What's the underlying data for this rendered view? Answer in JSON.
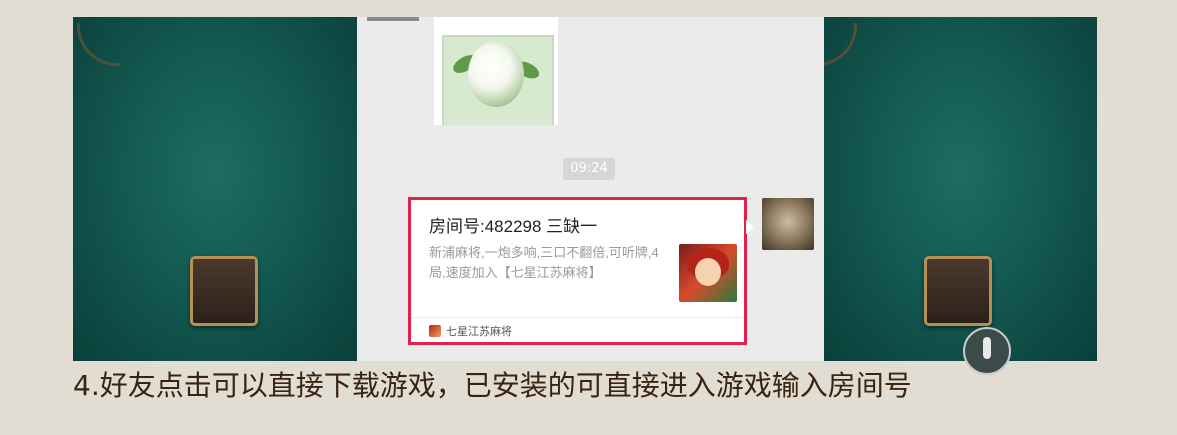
{
  "chat": {
    "timestamp": "09:24",
    "room_card": {
      "title": "房间号:482298  三缺一",
      "description": "新浦麻将,一炮多响,三口不翻倍,可听牌,4局,速度加入【七星江苏麻将】",
      "app_name": "七星江苏麻将"
    }
  },
  "caption": "4.好友点击可以直接下载游戏，已安装的可直接进入游戏输入房间号",
  "colors": {
    "highlight_border": "#e0224a",
    "felt_green": "#135a52",
    "chat_bg": "#ebebeb",
    "caption_text": "#3a2410"
  }
}
